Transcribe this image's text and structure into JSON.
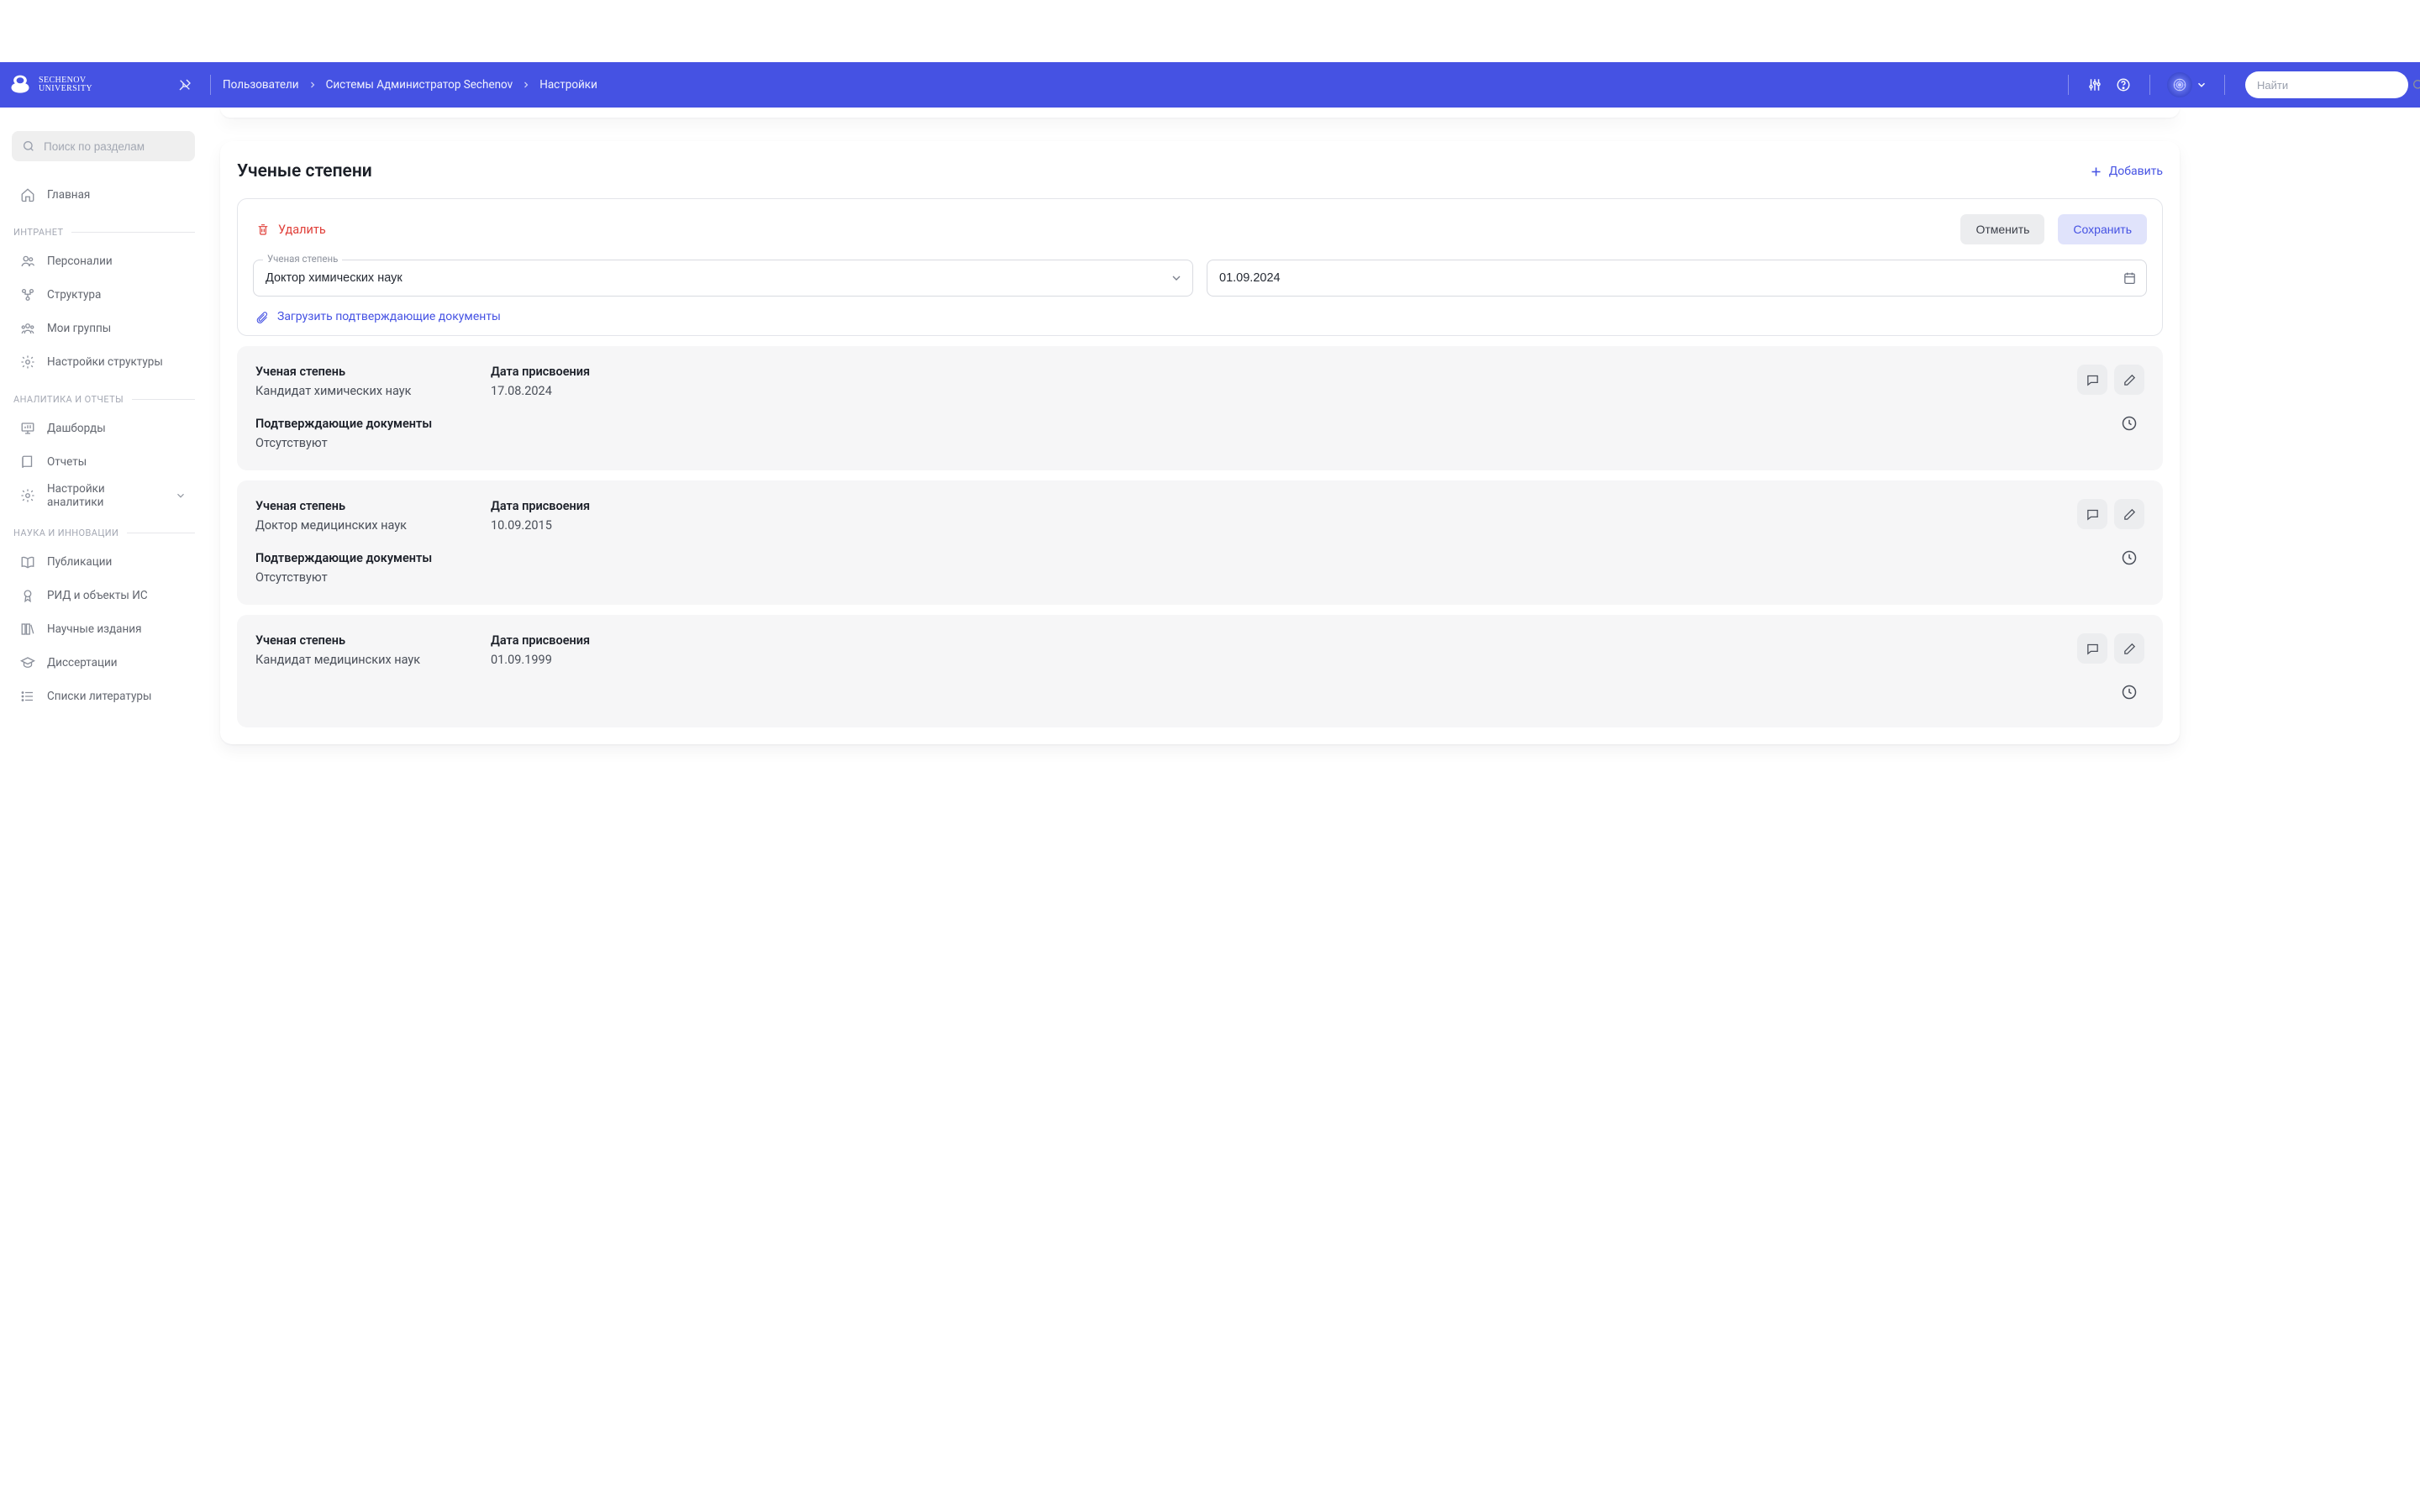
{
  "logo_lines": {
    "l1": "SECHENOV",
    "l2": "UNIVERSITY"
  },
  "header": {
    "breadcrumb": [
      "Пользователи",
      "Системы Администратор Sechenov",
      "Настройки"
    ],
    "search_placeholder": "Найти"
  },
  "sidebar": {
    "search_placeholder": "Поиск по разделам",
    "sections": [
      {
        "label": null,
        "items": [
          {
            "name": "home",
            "label": "Главная"
          }
        ]
      },
      {
        "label": "ИНТРАНЕТ",
        "items": [
          {
            "name": "personas",
            "label": "Персоналии"
          },
          {
            "name": "structure",
            "label": "Структура"
          },
          {
            "name": "mygroups",
            "label": "Мои группы"
          },
          {
            "name": "struct-settings",
            "label": "Настройки структуры"
          }
        ]
      },
      {
        "label": "АНАЛИТИКА И ОТЧЕТЫ",
        "items": [
          {
            "name": "dashboards",
            "label": "Дашборды"
          },
          {
            "name": "reports",
            "label": "Отчеты"
          },
          {
            "name": "analytics-settings",
            "label": "Настройки аналитики",
            "sub": true
          }
        ]
      },
      {
        "label": "НАУКА И ИННОВАЦИИ",
        "items": [
          {
            "name": "publications",
            "label": "Публикации"
          },
          {
            "name": "rid",
            "label": "РИД и объекты ИС"
          },
          {
            "name": "journals",
            "label": "Научные издания"
          },
          {
            "name": "dissertations",
            "label": "Диссертации"
          },
          {
            "name": "bibliography",
            "label": "Списки литературы"
          }
        ]
      }
    ]
  },
  "panel": {
    "title": "Ученые степени",
    "add_label": "Добавить",
    "edit": {
      "delete_label": "Удалить",
      "cancel_label": "Отменить",
      "save_label": "Сохранить",
      "degree_label": "Ученая степень",
      "degree_value": "Доктор химических наук",
      "date_value": "01.09.2024",
      "upload_label": "Загрузить подтверждающие документы"
    },
    "labels": {
      "degree": "Ученая степень",
      "date": "Дата присвоения",
      "docs": "Подтверждающие документы",
      "none": "Отсутствуют"
    },
    "items": [
      {
        "degree": "Кандидат химических наук",
        "date": "17.08.2024"
      },
      {
        "degree": "Доктор медицинских наук",
        "date": "10.09.2015"
      },
      {
        "degree": "Кандидат медицинских наук",
        "date": "01.09.1999"
      }
    ]
  }
}
